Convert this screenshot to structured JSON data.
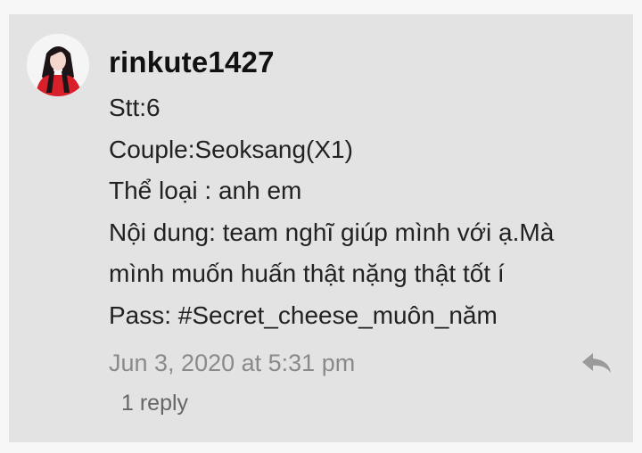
{
  "comment": {
    "username": "rinkute1427",
    "lines": [
      "Stt:6",
      "Couple:Seoksang(X1)",
      "Thể loại : anh em",
      "Nội dung: team nghĩ giúp mình với ạ.Mà",
      "mình muốn huấn thật nặng thật tốt í",
      "Pass: #Secret_cheese_muôn_năm"
    ],
    "timestamp": "Jun 3, 2020 at 5:31 pm",
    "reply_count": "1 reply",
    "reply_icon": "reply-arrow-icon"
  },
  "colors": {
    "card_background": "#e3e3e3",
    "page_background": "#f7f7f7",
    "timestamp": "#8a8a8a",
    "reply_icon": "#9a9a9a"
  }
}
